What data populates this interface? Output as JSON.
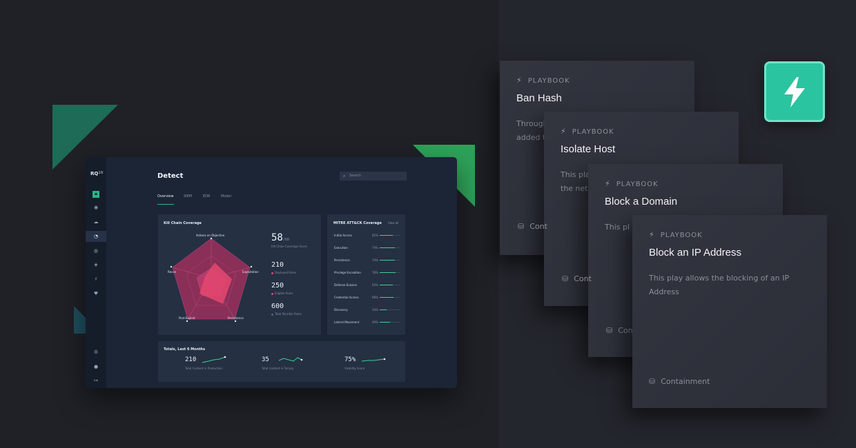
{
  "dashboard": {
    "logo": "RQ",
    "logo_sup": "10",
    "title": "Detect",
    "search_placeholder": "Search",
    "tabs": [
      "Overview",
      "SIEM",
      "EDR",
      "Model"
    ],
    "kill_chain": {
      "title": "Kill Chain Coverage",
      "radar_labels": [
        "Actions on Objective",
        "Exploitation",
        "Persistence",
        "Post-Exploit",
        "Recon"
      ],
      "score": "58",
      "score_suffix": "/60",
      "score_label": "Kill Chain Coverage Score",
      "stats": [
        {
          "value": "210",
          "label": "Deployed Rules",
          "color": "#e5466f"
        },
        {
          "value": "250",
          "label": "Eligible Rules",
          "color": "#e5466f"
        },
        {
          "value": "600",
          "label": "Total Possible Rules",
          "color": "#5a6678"
        }
      ]
    },
    "mitre": {
      "title": "MITRE ATT&CK Coverage",
      "view_all": "View all",
      "rows": [
        {
          "name": "Initial Access",
          "pct": "62%",
          "value": 0.62
        },
        {
          "name": "Execution",
          "pct": "74%",
          "value": 0.74
        },
        {
          "name": "Persistence",
          "pct": "74%",
          "value": 0.74
        },
        {
          "name": "Privilege Escalation",
          "pct": "78%",
          "value": 0.78
        },
        {
          "name": "Defense Evasion",
          "pct": "63%",
          "value": 0.63
        },
        {
          "name": "Credential Access",
          "pct": "68%",
          "value": 0.68
        },
        {
          "name": "Discovery",
          "pct": "34%",
          "value": 0.34
        },
        {
          "name": "Lateral Movement",
          "pct": "49%",
          "value": 0.49
        }
      ]
    },
    "totals": {
      "title": "Totals, Last 6 Months",
      "items": [
        {
          "value": "210",
          "label": "Total Content in Production"
        },
        {
          "value": "35",
          "label": "Total Content in Tuning"
        },
        {
          "value": "75%",
          "label": "Visibility Score"
        }
      ]
    }
  },
  "playbooks": [
    {
      "header": "PLAYBOOK",
      "title": "Ban Hash",
      "desc": "Through",
      "desc2": "added t",
      "footer": ""
    },
    {
      "header": "PLAYBOOK",
      "title": "Isolate Host",
      "desc": "This pla",
      "desc2": "the netw",
      "footer": "Cont"
    },
    {
      "header": "PLAYBOOK",
      "title": "Block a Domain",
      "desc": "This pl",
      "desc2": "",
      "footer": "Cont"
    },
    {
      "header": "PLAYBOOK",
      "title": "Block an IP Address",
      "desc": "This play allows the blocking of an IP Address",
      "desc2": "",
      "footer": "Containment"
    }
  ],
  "colors": {
    "accent": "#2bc4a0",
    "radar": "#e5466f",
    "bar": "#3fd08e"
  }
}
